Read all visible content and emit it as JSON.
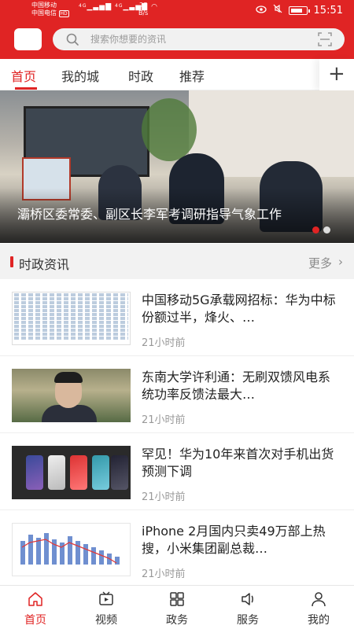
{
  "status_bar": {
    "carrier_1": "中国移动",
    "carrier_2": "中国电信",
    "hd": "HD",
    "signal_1": "4G",
    "signal_2": "4G",
    "net_speed_value": "27",
    "net_speed_unit": "B/s",
    "battery_icon": "battery-icon",
    "time": "15:51"
  },
  "search": {
    "placeholder": "搜索你想要的资讯",
    "icon": "search-icon",
    "scan_icon": "scan-icon"
  },
  "tabs": [
    {
      "label": "首页",
      "active": true
    },
    {
      "label": "我的城",
      "active": false
    },
    {
      "label": "时政",
      "active": false
    },
    {
      "label": "推荐",
      "active": false
    }
  ],
  "tabs_add_label": "+",
  "banner": {
    "title": "灞桥区委常委、副区长李军考调研指导气象工作",
    "slide_count": 2,
    "active_slide": 1
  },
  "section": {
    "label": "时政资讯",
    "more": "更多",
    "more_chevron": "›"
  },
  "news": [
    {
      "headline": "中国移动5G承载网招标：华为中标份额过半，烽火、…",
      "time": "21小时前",
      "thumb": "table-thumbnail"
    },
    {
      "headline": "东南大学许利通：无刷双馈风电系统功率反馈法最大…",
      "time": "21小时前",
      "thumb": "portrait-thumbnail"
    },
    {
      "headline": "罕见！华为10年来首次对手机出货预测下调",
      "time": "21小时前",
      "thumb": "phones-thumbnail"
    },
    {
      "headline": "iPhone 2月国内只卖49万部上热搜，小米集团副总裁…",
      "time": "21小时前",
      "thumb": "chart-thumbnail"
    }
  ],
  "bottom_nav": [
    {
      "label": "首页",
      "icon": "home-icon",
      "active": true
    },
    {
      "label": "视频",
      "icon": "video-icon",
      "active": false
    },
    {
      "label": "政务",
      "icon": "grid-icon",
      "active": false
    },
    {
      "label": "服务",
      "icon": "speaker-icon",
      "active": false
    },
    {
      "label": "我的",
      "icon": "user-icon",
      "active": false
    }
  ],
  "colors": {
    "brand_red": "#e02424",
    "muted_text": "#999999",
    "section_bg": "#f2f2f2"
  }
}
